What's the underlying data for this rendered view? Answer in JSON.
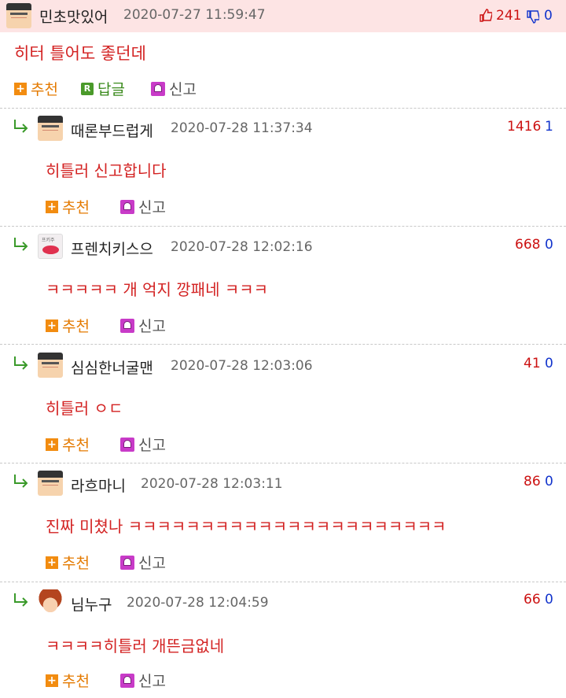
{
  "post": {
    "nick": "민초맛있어",
    "date": "2020-07-27 11:59:47",
    "up": "241",
    "down": "0",
    "title": "히터 틀어도 좋던데",
    "rec_label": "추천",
    "reply_label": "답글",
    "report_label": "신고"
  },
  "comments": [
    {
      "nick": "때론부드럽게",
      "date": "2020-07-28 11:37:34",
      "up": "1416",
      "down": "1",
      "text": "히틀러 신고합니다",
      "rec": "추천",
      "report": "신고"
    },
    {
      "nick": "프렌치키스으",
      "date": "2020-07-28 12:02:16",
      "up": "668",
      "down": "0",
      "text": "ㅋㅋㅋㅋㅋ 개 억지 깡패네 ㅋㅋㅋ",
      "rec": "추천",
      "report": "신고"
    },
    {
      "nick": "심심한너굴맨",
      "date": "2020-07-28 12:03:06",
      "up": "41",
      "down": "0",
      "text": "히틀러 ㅇㄷ",
      "rec": "추천",
      "report": "신고"
    },
    {
      "nick": "라흐마니",
      "date": "2020-07-28 12:03:11",
      "up": "86",
      "down": "0",
      "text": "진짜 미쳤나 ㅋㅋㅋㅋㅋㅋㅋㅋㅋㅋㅋㅋㅋㅋㅋㅋㅋㅋㅋㅋㅋㅋ",
      "rec": "추천",
      "report": "신고"
    },
    {
      "nick": "님누구",
      "date": "2020-07-28 12:04:59",
      "up": "66",
      "down": "0",
      "text": "ㅋㅋㅋㅋ히틀러 개뜬금없네",
      "rec": "추천",
      "report": "신고"
    }
  ],
  "colors": {
    "accent_red": "#d32222",
    "up": "#cc1111",
    "down": "#1133cc",
    "header_bg": "#fde4e4"
  }
}
